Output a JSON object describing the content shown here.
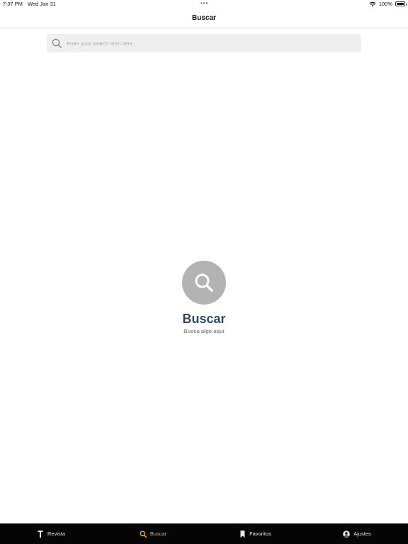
{
  "status_bar": {
    "time": "7:37 PM",
    "date": "Wed Jan 31",
    "multitask_dots": "•••",
    "battery_percent": "100%",
    "battery_level": 1.0
  },
  "nav": {
    "title": "Buscar"
  },
  "search": {
    "placeholder": "Enter your search term here...",
    "value": "",
    "icon": "search-icon"
  },
  "empty_state": {
    "icon": "search-icon",
    "title": "Buscar",
    "subtitle": "Busca algo aquí"
  },
  "tab_bar": {
    "items": [
      {
        "label": "Revista",
        "icon": "revista-t-icon",
        "active": false
      },
      {
        "label": "Buscar",
        "icon": "search-icon",
        "active": true
      },
      {
        "label": "Favoritos",
        "icon": "bookmark-icon",
        "active": false
      },
      {
        "label": "Ajustes",
        "icon": "user-icon",
        "active": false
      }
    ]
  },
  "colors": {
    "accent": "#f1b722",
    "tab_bar_bg": "#050505",
    "empty_title": "#2e4a63",
    "empty_circle": "#b3b3b3",
    "search_bg": "#efefef"
  }
}
